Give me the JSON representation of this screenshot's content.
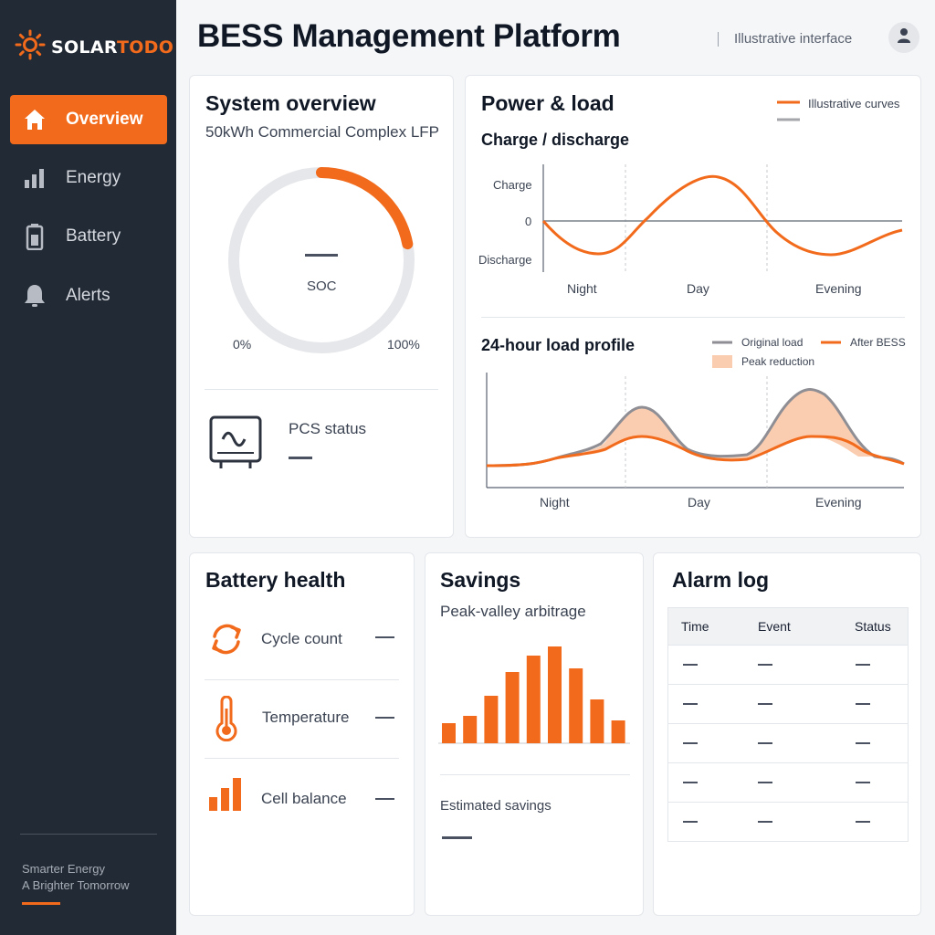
{
  "brand": {
    "logo_white": "SOLAR",
    "logo_orange": "TODO",
    "logo_icon": "sun-icon"
  },
  "sidebar": {
    "items": [
      {
        "label": "Overview",
        "icon": "home-icon",
        "active": true
      },
      {
        "label": "Energy",
        "icon": "bar-chart-icon",
        "active": false
      },
      {
        "label": "Battery",
        "icon": "battery-icon",
        "active": false
      },
      {
        "label": "Alerts",
        "icon": "bell-icon",
        "active": false
      }
    ],
    "tagline_1": "Smarter Energy",
    "tagline_2": "A Brighter Tomorrow"
  },
  "header": {
    "title": "BESS Management Platform",
    "note": "Illustrative interface",
    "avatar_icon": "user-icon"
  },
  "colors": {
    "accent": "#f26a1b",
    "sidebar": "#222a35",
    "peak_fill": "#fbcdb0",
    "original_line": "#8e8e94"
  },
  "system_overview": {
    "title": "System overview",
    "subtitle": "50kWh Commercial Complex LFP",
    "gauge_label": "SOC",
    "gauge_min": "0%",
    "gauge_max": "100%",
    "gauge_value": "—",
    "soc_arc_fraction": 0.22,
    "pcs_label": "PCS status",
    "pcs_value": "—",
    "pcs_icon": "inverter-icon"
  },
  "power_load": {
    "title": "Power & load",
    "legend_note": "Illustrative curves",
    "charge_title": "Charge / discharge",
    "y_labels": [
      "Charge",
      "0",
      "Discharge"
    ],
    "x_labels": [
      "Night",
      "Day",
      "Evening"
    ],
    "profile_title": "24-hour load profile",
    "legend_original": "Original load",
    "legend_after": "After BESS",
    "legend_peak": "Peak reduction",
    "profile_x_labels": [
      "Night",
      "Day",
      "Evening"
    ]
  },
  "battery_health": {
    "title": "Battery health",
    "rows": [
      {
        "label": "Cycle count",
        "value": "—",
        "icon": "cycle-icon"
      },
      {
        "label": "Temperature",
        "value": "—",
        "icon": "thermometer-icon"
      },
      {
        "label": "Cell balance",
        "value": "—",
        "icon": "cell-bars-icon"
      }
    ]
  },
  "savings": {
    "title": "Savings",
    "subtitle": "Peak-valley arbitrage",
    "estimated_label": "Estimated savings",
    "estimated_value": "—"
  },
  "alarm_log": {
    "title": "Alarm log",
    "columns": [
      "Time",
      "Event",
      "Status"
    ],
    "rows": [
      [
        "—",
        "—",
        "—"
      ],
      [
        "—",
        "—",
        "—"
      ],
      [
        "—",
        "—",
        "—"
      ],
      [
        "—",
        "—",
        "—"
      ],
      [
        "—",
        "—",
        "—"
      ]
    ]
  },
  "chart_data": [
    {
      "type": "line",
      "title": "Charge / discharge",
      "x": [
        "Night",
        "Day",
        "Evening"
      ],
      "y_labels": [
        "Charge",
        "0",
        "Discharge"
      ],
      "series": [
        {
          "values": [
            0,
            -0.45,
            0.6,
            -0.45,
            0.15
          ]
        }
      ]
    },
    {
      "type": "area",
      "title": "24-hour load profile",
      "x": [
        "Night",
        "Day",
        "Evening"
      ],
      "series": [
        {
          "name": "Original load",
          "values": [
            0.0,
            0.05,
            0.55,
            0.1,
            0.1,
            0.85,
            0.08,
            -0.1
          ]
        },
        {
          "name": "After BESS",
          "values": [
            0.0,
            0.05,
            0.3,
            0.1,
            0.08,
            0.32,
            0.08,
            -0.1
          ]
        }
      ]
    },
    {
      "type": "bar",
      "title": "Peak-valley arbitrage",
      "values": [
        22,
        30,
        52,
        78,
        96,
        106,
        82,
        48,
        25
      ]
    }
  ]
}
